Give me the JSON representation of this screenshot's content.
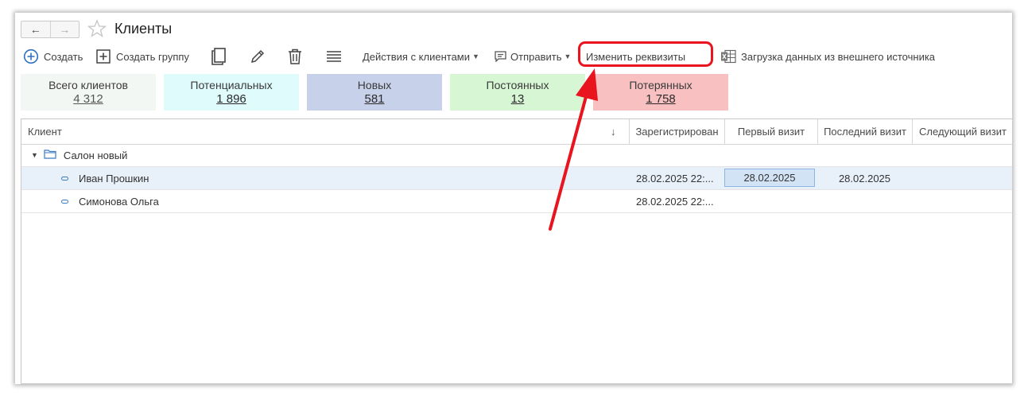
{
  "window": {
    "title": "Клиенты",
    "back_icon": "←",
    "forward_icon": "→"
  },
  "toolbar": {
    "create": "Создать",
    "create_group": "Создать группу",
    "actions": "Действия с клиентами",
    "send": "Отправить",
    "change_details": "Изменить реквизиты",
    "load_data": "Загрузка данных из внешнего источника"
  },
  "tiles": [
    {
      "label": "Всего клиентов",
      "value": "4 312",
      "color": "#f3f7f3"
    },
    {
      "label": "Потенциальных",
      "value": "1 896",
      "color": "#dffbfb"
    },
    {
      "label": "Новых",
      "value": "581",
      "color": "#c7d2ea"
    },
    {
      "label": "Постоянных",
      "value": "13",
      "color": "#d6f6d4"
    },
    {
      "label": "Потерянных",
      "value": "1 758",
      "color": "#f8c0c0"
    }
  ],
  "table": {
    "columns": [
      "Клиент",
      "Зарегистрирован",
      "Первый визит",
      "Последний визит",
      "Следующий визит"
    ],
    "sort_indicator": "↓",
    "group": "Салон новый",
    "rows": [
      {
        "name": "Иван Прошкин",
        "registered": "28.02.2025 22:...",
        "first_visit": "28.02.2025",
        "last_visit": "28.02.2025",
        "next_visit": ""
      },
      {
        "name": "Симонова Ольга",
        "registered": "28.02.2025 22:...",
        "first_visit": "",
        "last_visit": "",
        "next_visit": ""
      }
    ]
  },
  "colors": {
    "accent_red": "#e8141e",
    "icon_blue": "#2f6fc0"
  }
}
